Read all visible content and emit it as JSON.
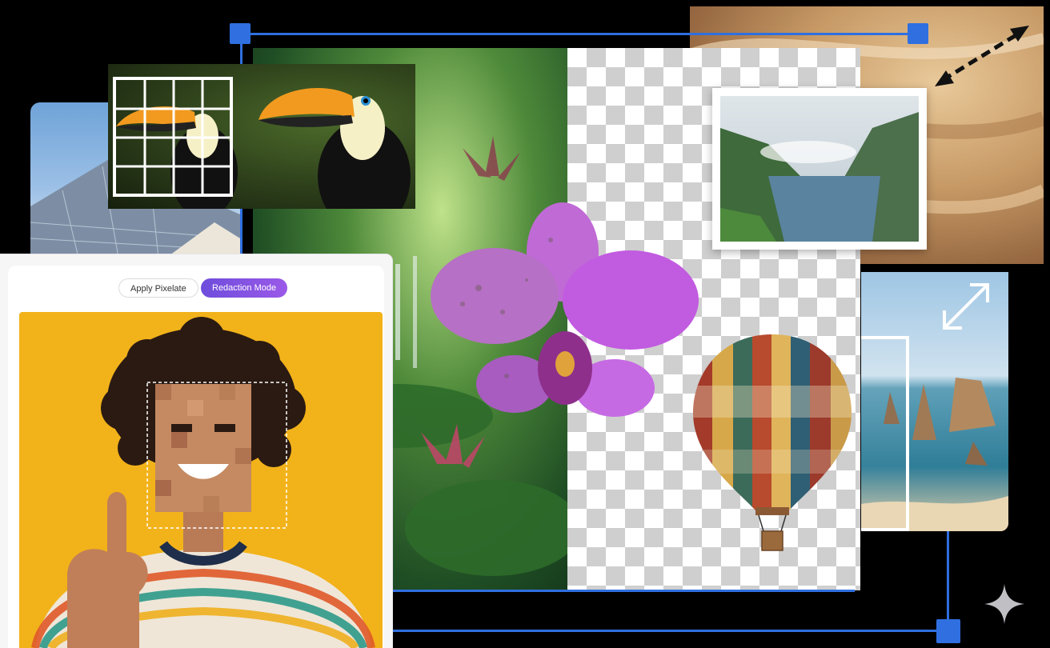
{
  "editor": {
    "apply_pixelate_label": "Apply Pixelate",
    "redaction_mode_label": "Redaction Mode"
  },
  "colors": {
    "accent_blue": "#2f6fe0",
    "accent_purple": "#7a52e4",
    "portrait_bg": "#f2b21a"
  },
  "icons": {
    "resize_top": "double-arrow-diagonal-icon",
    "resize_right": "expand-diagonal-icon",
    "sparkle": "sparkle-icon"
  }
}
